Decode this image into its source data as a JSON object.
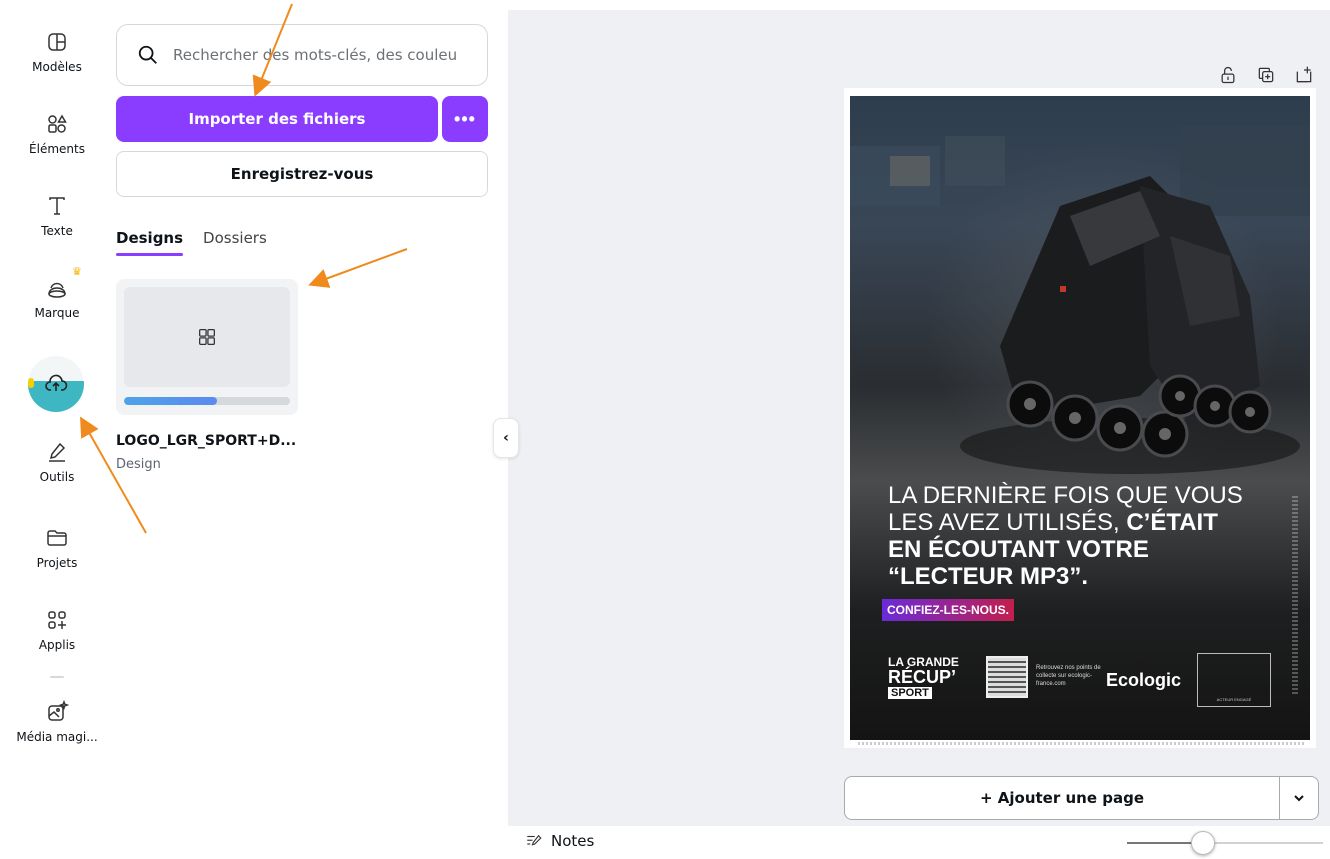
{
  "rail": {
    "items": [
      {
        "label": "Modèles",
        "icon": "layout-icon"
      },
      {
        "label": "Éléments",
        "icon": "shapes-icon"
      },
      {
        "label": "Texte",
        "icon": "text-icon"
      },
      {
        "label": "Marque",
        "icon": "brand-icon"
      },
      {
        "label": "",
        "icon": "cloud-upload-icon"
      },
      {
        "label": "Outils",
        "icon": "draw-icon"
      },
      {
        "label": "Projets",
        "icon": "folder-icon"
      },
      {
        "label": "Applis",
        "icon": "apps-icon"
      },
      {
        "label": "Média magi...",
        "icon": "magic-media-icon"
      }
    ]
  },
  "panel": {
    "search_placeholder": "Rechercher des mots-clés, des couleu",
    "import_label": "Importer des fichiers",
    "more_label": "•••",
    "register_label": "Enregistrez-vous",
    "tabs": [
      "Designs",
      "Dossiers"
    ],
    "design": {
      "name": "LOGO_LGR_SPORT+D...",
      "type": "Design",
      "upload_progress": 0.56
    }
  },
  "poster": {
    "headline_1": "LA DERNIÈRE FOIS QUE VOUS",
    "headline_2": "LES AVEZ UTILISÉS,",
    "headline_2b": "C’ÉTAIT",
    "headline_3": "EN ÉCOUTANT VOTRE",
    "headline_4": "“LECTEUR MP3”.",
    "badge": "CONFIEZ-LES-NOUS.",
    "logo_l1": "LA GRANDE",
    "logo_l2": "RÉCUP’",
    "logo_l3": "SPORT",
    "qr_text": "Retrouvez nos points de collecte sur ecologic-france.com",
    "brand": "Ecologic",
    "engaged": "ACTEUR ENGAGÉ"
  },
  "canvas": {
    "add_page_label": "+ Ajouter une page",
    "notes_label": "Notes",
    "zoom_level": 0.38
  },
  "colors": {
    "accent": "#8b3dff",
    "annotation": "#f08a1c",
    "upload_bg": "#3fb7c2"
  }
}
